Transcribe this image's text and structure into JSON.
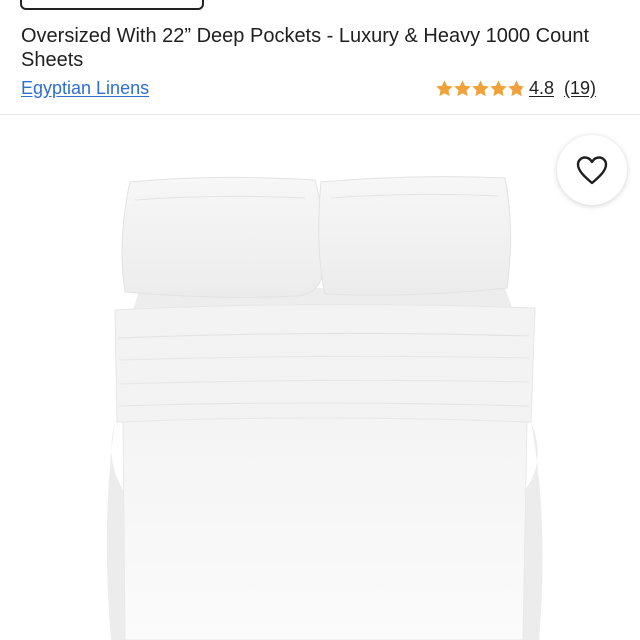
{
  "product": {
    "title": "Oversized With 22” Deep Pockets - Luxury & Heavy 1000 Count Sheets",
    "brand": "Egyptian Linens",
    "rating_value": "4.8",
    "rating_count": "(19)",
    "rating_stars": 4.8,
    "rating_max": 5
  },
  "icons": {
    "favorite": "heart-outline-icon",
    "star": "star-icon"
  },
  "colors": {
    "link": "#2f6fd0",
    "star": "#f0a23a",
    "text": "#1f1f1f"
  }
}
